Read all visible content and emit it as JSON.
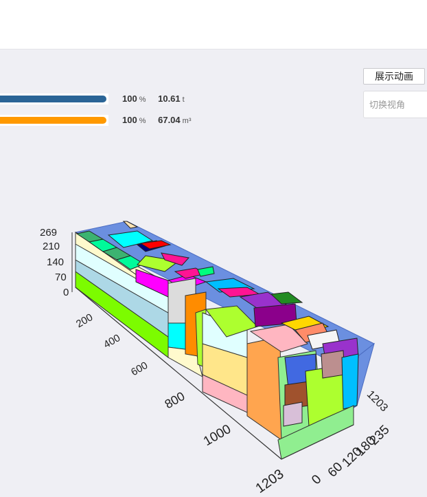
{
  "controls": {
    "animate_button": "展示动画",
    "view_select_placeholder": "切换视角"
  },
  "weight": {
    "percent": "100",
    "percent_unit": "%",
    "value": "10.61",
    "unit": "t",
    "fill_fraction": 1.0,
    "color": "#2a6496"
  },
  "volume": {
    "percent": "100",
    "percent_unit": "%",
    "value": "67.04",
    "unit": "m³",
    "fill_fraction": 1.0,
    "color": "#ff9900"
  },
  "axes": {
    "z_ticks": [
      "269",
      "210",
      "140",
      "70",
      "0"
    ],
    "x_ticks": [
      "200",
      "400",
      "600",
      "800",
      "1000",
      "1203"
    ],
    "y_ticks": [
      "0",
      "60",
      "120",
      "180",
      "235"
    ],
    "end_label": "1203"
  }
}
